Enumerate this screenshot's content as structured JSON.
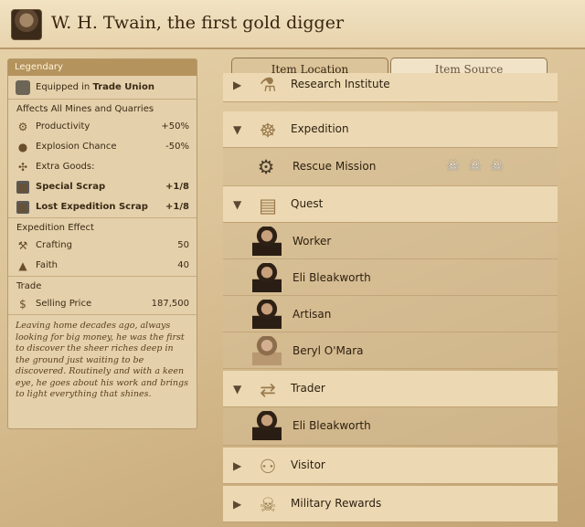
{
  "header": {
    "title": "W. H. Twain, the first gold digger",
    "portrait_icon": "miner-portrait-icon"
  },
  "legend": {
    "heading": "Legendary",
    "equipped_prefix": "Equipped in",
    "equipped_place": "Trade Union",
    "affects": "Affects All Mines and Quarries",
    "stats": [
      {
        "icon": "gear-icon",
        "label": "Productivity",
        "value": "+50%"
      },
      {
        "icon": "bomb-icon",
        "label": "Explosion Chance",
        "value": "-50%"
      },
      {
        "icon": "plus-icon",
        "label": "Extra Goods:",
        "value": ""
      },
      {
        "icon": "scrap-icon",
        "label": "Special Scrap",
        "value": "+1/8"
      },
      {
        "icon": "scrap-icon",
        "label": "Lost Expedition Scrap",
        "value": "+1/8"
      }
    ],
    "expedition_heading": "Expedition Effect",
    "expedition": [
      {
        "icon": "tools-icon",
        "label": "Crafting",
        "value": "50"
      },
      {
        "icon": "faith-icon",
        "label": "Faith",
        "value": "40"
      }
    ],
    "trade_heading": "Trade",
    "trade": {
      "icon": "coin-icon",
      "label": "Selling Price",
      "value": "187,500"
    },
    "description": "Leaving home decades ago, always looking for big money, he was the first to discover the sheer riches deep in the ground just waiting to be discovered. Routinely and with a keen eye, he goes about his work and brings to light everything that shines."
  },
  "tabs": {
    "location": "Item Location",
    "source": "Item Source"
  },
  "sources": {
    "research": "Research Institute",
    "expedition": "Expedition",
    "rescue": "Rescue Mission",
    "quest": "Quest",
    "worker": "Worker",
    "eli1": "Eli Bleakworth",
    "artisan": "Artisan",
    "beryl": "Beryl O'Mara",
    "trader": "Trader",
    "eli2": "Eli Bleakworth",
    "visitor": "Visitor",
    "military": "Military Rewards"
  }
}
